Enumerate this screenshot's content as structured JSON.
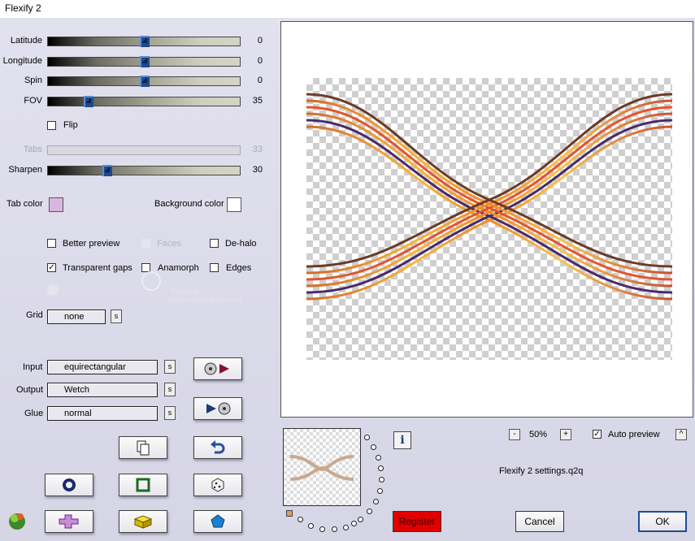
{
  "window": {
    "title": "Flexify 2"
  },
  "sliders": [
    {
      "label": "Latitude",
      "value": "0",
      "position": 0.5,
      "enabled": true
    },
    {
      "label": "Longitude",
      "value": "0",
      "position": 0.5,
      "enabled": true
    },
    {
      "label": "Spin",
      "value": "0",
      "position": 0.5,
      "enabled": true
    },
    {
      "label": "FOV",
      "value": "35",
      "position": 0.2,
      "enabled": true
    },
    {
      "label": "Tabs",
      "value": "33",
      "position": 0.33,
      "enabled": false
    },
    {
      "label": "Sharpen",
      "value": "30",
      "position": 0.3,
      "enabled": true
    }
  ],
  "flip": {
    "label": "Flip",
    "checked": false
  },
  "tab_color": {
    "label": "Tab color",
    "color": "#d9b6e0"
  },
  "background_color": {
    "label": "Background color",
    "color": "#ffffff"
  },
  "options": {
    "better_preview": {
      "label": "Better preview",
      "checked": false
    },
    "faces": {
      "label": "Faces",
      "checked": false,
      "enabled": false
    },
    "de_halo": {
      "label": "De-halo",
      "checked": false
    },
    "transparent_gaps": {
      "label": "Transparent gaps",
      "checked": true
    },
    "anamorph": {
      "label": "Anamorph",
      "checked": false
    },
    "edges": {
      "label": "Edges",
      "checked": false
    }
  },
  "grid": {
    "label": "Grid",
    "value": "none",
    "s": "s"
  },
  "input": {
    "label": "Input",
    "value": "equirectangular",
    "s": "s"
  },
  "output": {
    "label": "Output",
    "value": "Wetch",
    "s": "s"
  },
  "glue": {
    "label": "Glue",
    "value": "normal",
    "s": "s"
  },
  "watermark": {
    "line1": "Pinuccia",
    "line2": "www.maidiragrafica.eu"
  },
  "zoom": {
    "minus": "-",
    "value": "50%",
    "plus": "+"
  },
  "auto_preview": {
    "label": "Auto preview",
    "checked": true,
    "arrow": "^"
  },
  "settings_file": "Flexify 2 settings.q2q",
  "info": "i",
  "buttons": {
    "register": "Register",
    "cancel": "Cancel",
    "ok": "OK"
  },
  "colors": {
    "register_bg": "#e00000",
    "accent_blue": "#1d4b8c"
  }
}
